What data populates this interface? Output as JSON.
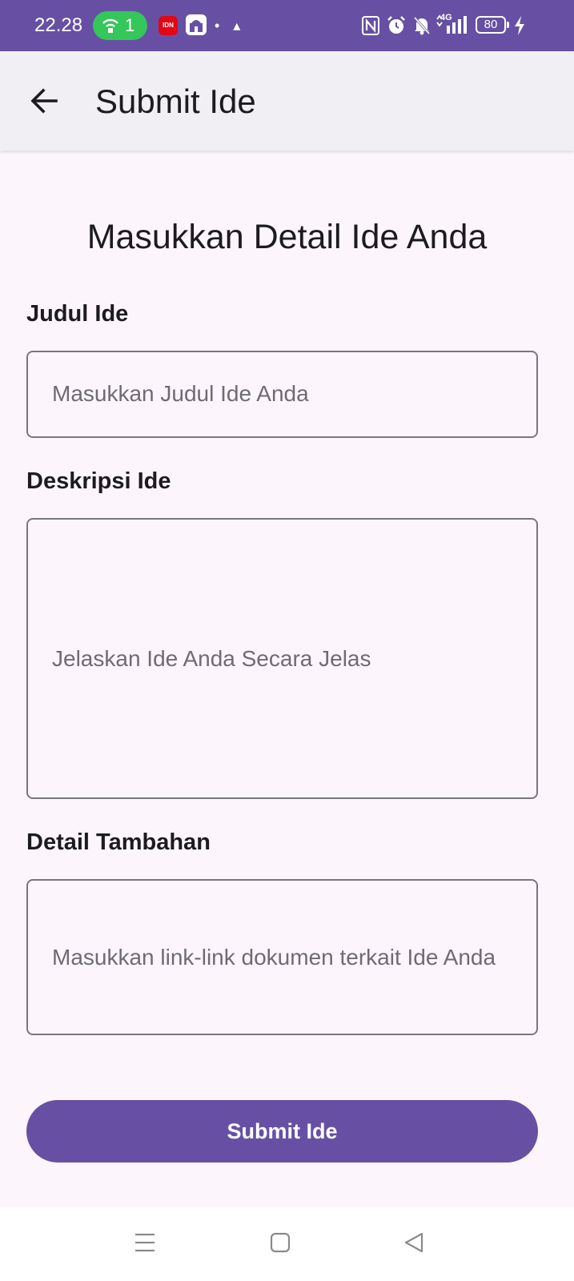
{
  "status_bar": {
    "time": "22.28",
    "hotspot_count": "1",
    "idn_app_label": "IDN",
    "dots": "• ▴",
    "network": "4G",
    "battery": "80",
    "icons": [
      "hotspot-icon",
      "idn-app-icon",
      "mosque-app-icon",
      "nfc-icon",
      "alarm-icon",
      "bell-off-icon",
      "signal-icon",
      "battery-icon",
      "charging-icon"
    ]
  },
  "app_bar": {
    "title": "Submit Ide",
    "back_icon": "arrow-back-icon"
  },
  "form": {
    "heading": "Masukkan Detail Ide Anda",
    "title_label": "Judul Ide",
    "title_placeholder": "Masukkan Judul Ide Anda",
    "title_value": "",
    "description_label": "Deskripsi Ide",
    "description_placeholder": "Jelaskan Ide Anda Secara Jelas",
    "description_value": "",
    "details_label": "Detail Tambahan",
    "details_placeholder": "Masukkan link-link dokumen terkait Ide Anda",
    "details_value": "",
    "submit_label": "Submit Ide"
  },
  "nav_bar": {
    "icons": [
      "menu-icon",
      "home-icon",
      "back-triangle-icon"
    ]
  },
  "colors": {
    "primary": "#6750a4",
    "app_bar_bg": "#f1eef4",
    "page_bg": "#fcf6fc",
    "field_border": "#7a757f",
    "placeholder": "#6f6a73",
    "hotspot": "#34c759"
  }
}
